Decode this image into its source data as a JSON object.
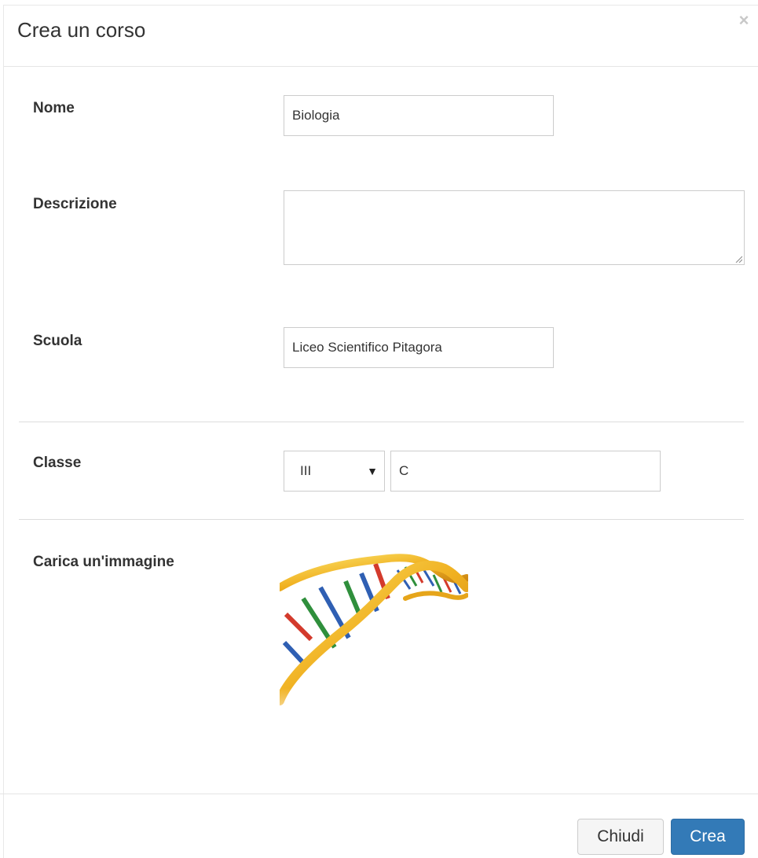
{
  "modal": {
    "title": "Crea un corso",
    "close_glyph": "×"
  },
  "form": {
    "nome": {
      "label": "Nome",
      "value": "Biologia"
    },
    "descrizione": {
      "label": "Descrizione",
      "value": ""
    },
    "scuola": {
      "label": "Scuola",
      "value": "Liceo Scientifico Pitagora"
    },
    "classe": {
      "label": "Classe",
      "year_selected": "III",
      "section_value": "C"
    },
    "immagine": {
      "label": "Carica un'immagine",
      "preview_icon": "dna-helix-image"
    }
  },
  "footer": {
    "close_label": "Chiudi",
    "create_label": "Crea"
  },
  "colors": {
    "primary": "#337ab7",
    "default_bg": "#f5f5f5",
    "border": "#cccccc"
  }
}
